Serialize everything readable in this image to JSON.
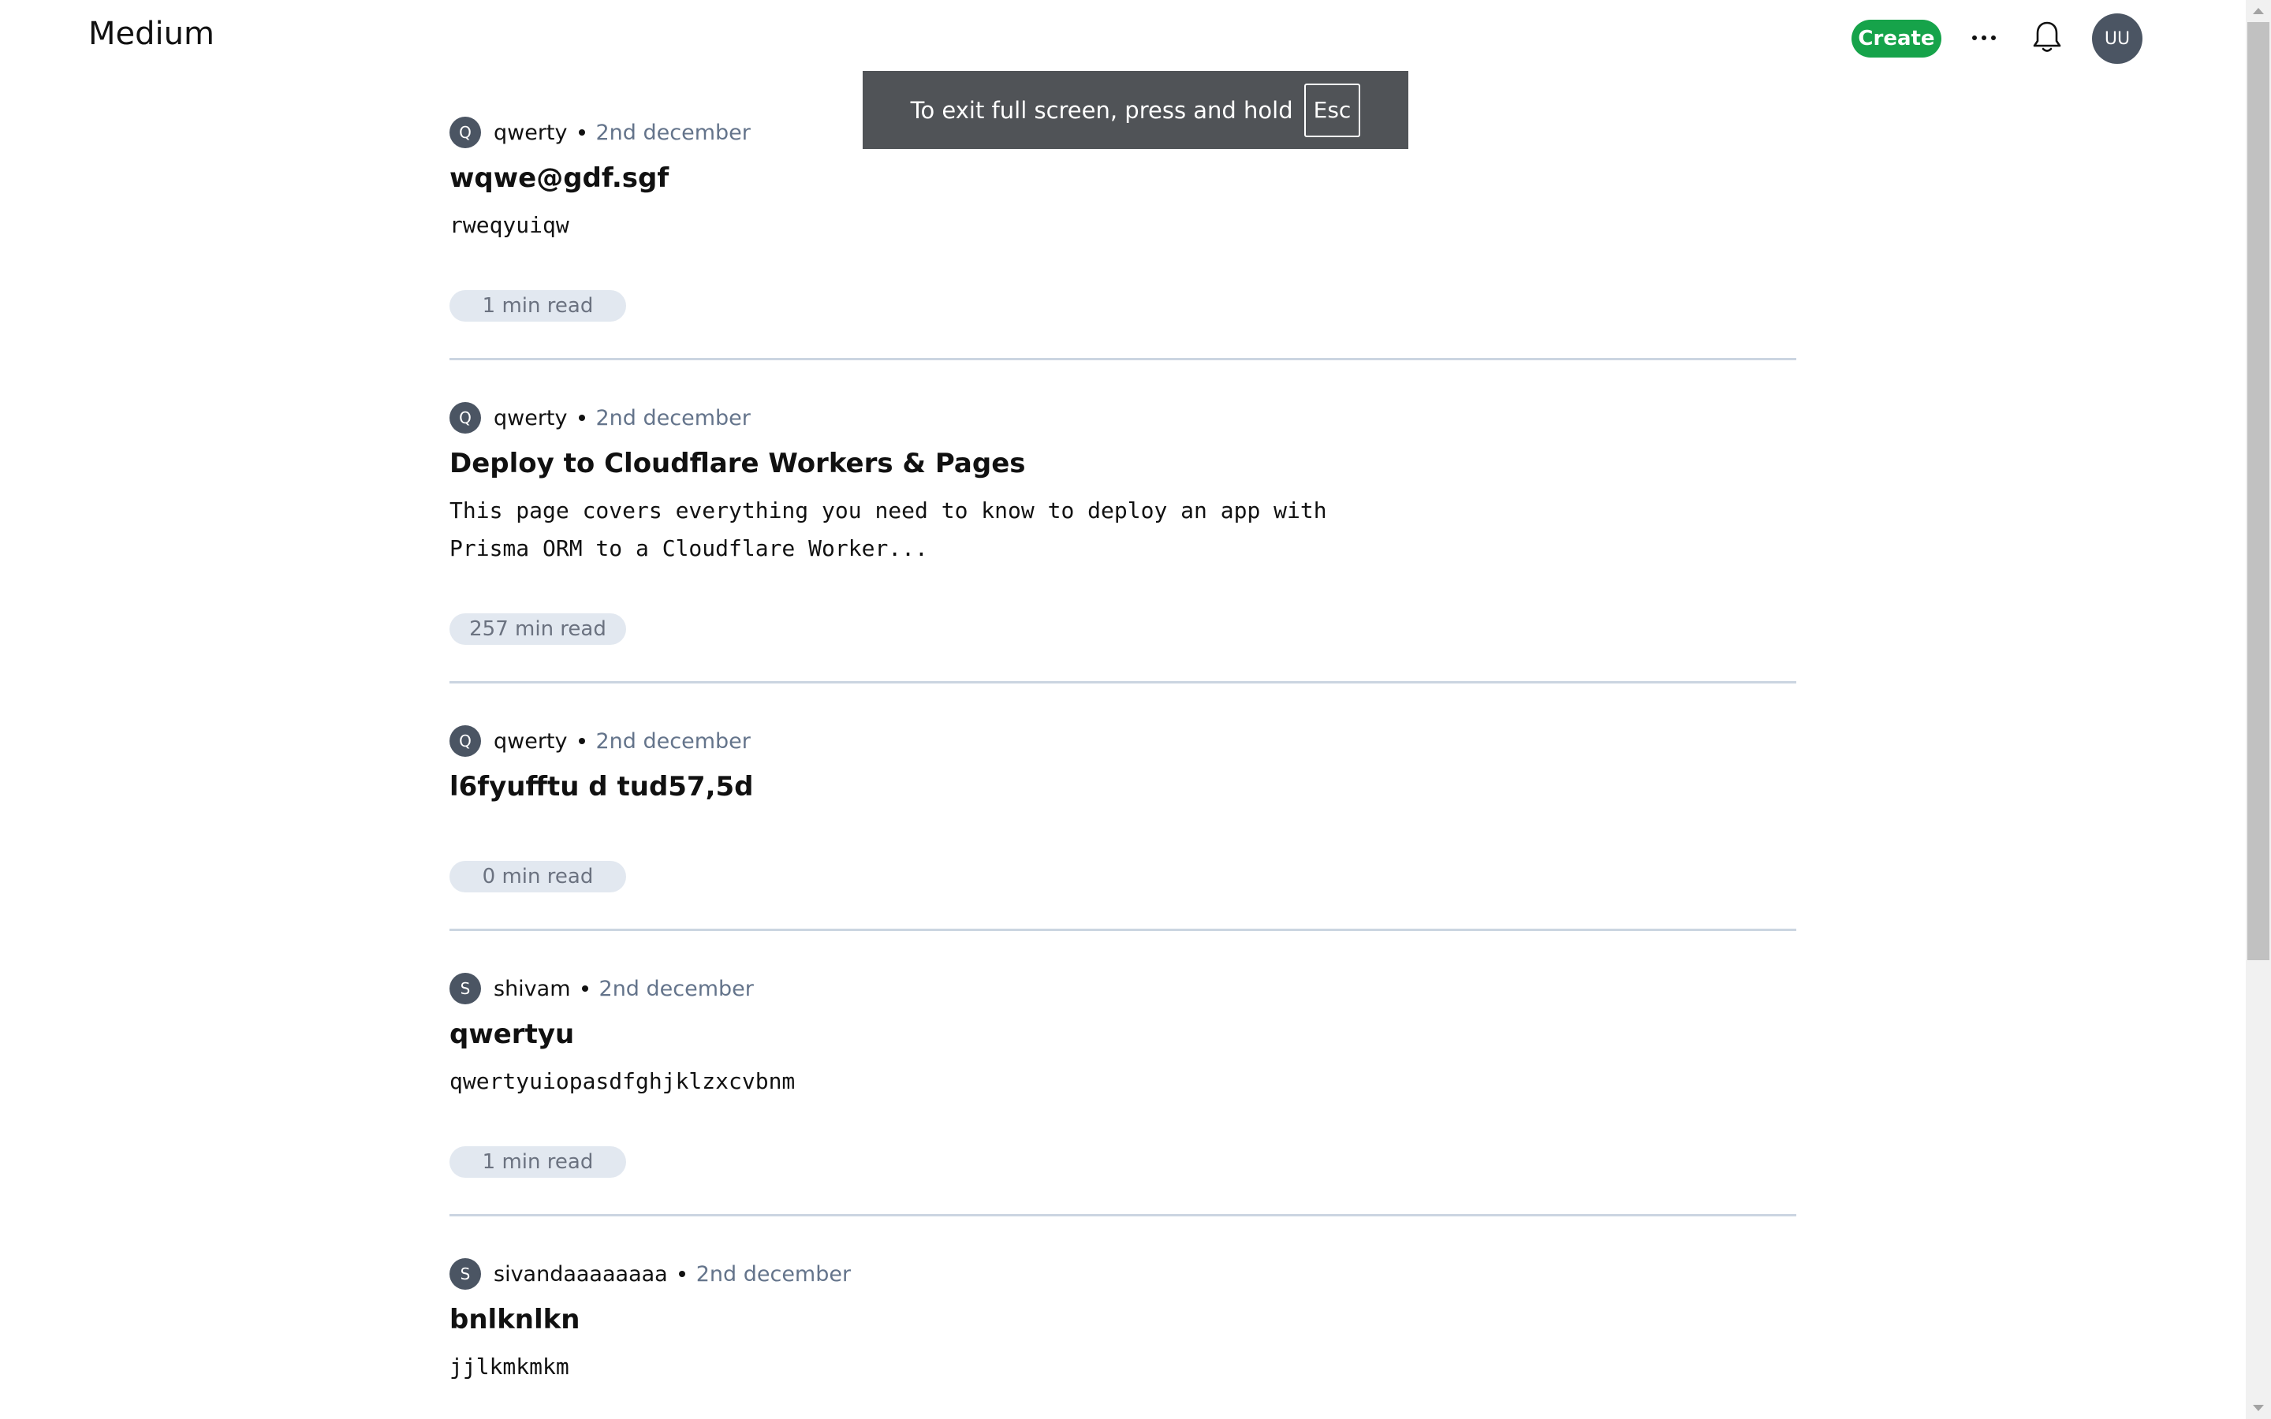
{
  "header": {
    "logo": "Medium",
    "create_label": "Create",
    "user_avatar": "UU",
    "icons": [
      "more-icon",
      "bell-icon"
    ]
  },
  "fullscreen_toast": {
    "message": "To exit full screen, press and hold",
    "key": "Esc"
  },
  "posts": [
    {
      "author_initial": "Q",
      "author": "qwerty",
      "date": "2nd december",
      "title": "wqwe@gdf.sgf",
      "excerpt": "rweqyuiqw",
      "read_time": "1 min read"
    },
    {
      "author_initial": "Q",
      "author": "qwerty",
      "date": "2nd december",
      "title": "Deploy to Cloudflare Workers & Pages",
      "excerpt_line1": "This page covers everything you need to know to deploy an app with",
      "excerpt_line2": "Prisma ORM to a Cloudflare Worker...",
      "read_time": "257 min read"
    },
    {
      "author_initial": "Q",
      "author": "qwerty",
      "date": "2nd december",
      "title": "l6fyufftu d tud57,5d",
      "excerpt": "",
      "read_time": "0 min read"
    },
    {
      "author_initial": "S",
      "author": "shivam",
      "date": "2nd december",
      "title": "qwertyu",
      "excerpt": "qwertyuiopasdfghjklzxcvbnm",
      "read_time": "1 min read"
    },
    {
      "author_initial": "S",
      "author": "sivandaaaaaaaa",
      "date": "2nd december",
      "title": "bnlknlkn",
      "excerpt": "jjlkmkmkm"
    }
  ],
  "colors": {
    "accent_green": "#16a34a",
    "avatar_gray": "#4b5563",
    "date_gray": "#64748b",
    "pill_bg": "#e2e8f0",
    "divider": "#cbd5e1"
  }
}
